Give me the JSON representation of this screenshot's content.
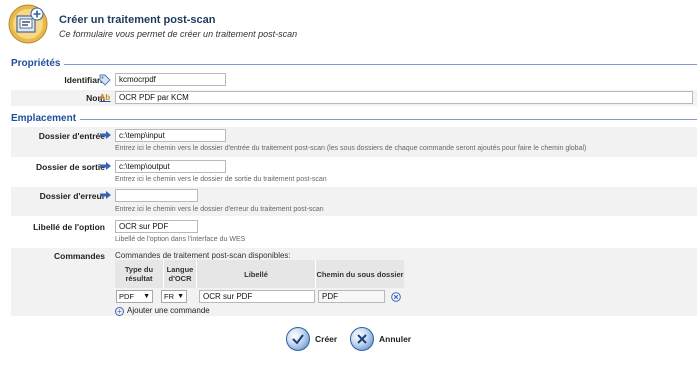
{
  "header": {
    "title": "Créer un traitement post-scan",
    "subtitle": "Ce formulaire vous permet de créer un traitement post-scan"
  },
  "proprietes": {
    "section_title": "Propriétés",
    "identifiant_label": "Identifiant",
    "identifiant_value": "kcmocrpdf",
    "nom_label": "Nom",
    "nom_value": "OCR PDF par KCM"
  },
  "emplacement": {
    "section_title": "Emplacement",
    "dossier_entree_label": "Dossier d'entrée",
    "dossier_entree_value": "c:\\temp\\input",
    "dossier_entree_help": "Entrez ici le chemin vers le dossier d'entrée du traitement post-scan (les sous dossiers de chaque commande seront ajoutés pour faire le chemin global)",
    "dossier_sortie_label": "Dossier de sortie",
    "dossier_sortie_value": "c:\\temp\\output",
    "dossier_sortie_help": "Entrez ici le chemin vers le dossier de sortie du traitement post-scan",
    "dossier_erreur_label": "Dossier d'erreur",
    "dossier_erreur_value": "",
    "dossier_erreur_help": "Entrez ici le chemin vers le dossier d'erreur du traitement post-scan",
    "libelle_option_label": "Libellé de l'option",
    "libelle_option_value": "OCR sur PDF",
    "libelle_option_help": "Libellé de l'option dans l'interface du WES"
  },
  "commandes": {
    "label": "Commandes",
    "caption": "Commandes de traitement post-scan disponibles:",
    "columns": [
      "Type du résultat",
      "Langue d'OCR",
      "Libellé",
      "Chemin du sous dossier"
    ],
    "row": {
      "type": "PDF",
      "langue": "FR",
      "libelle": "OCR sur PDF",
      "chemin": "PDF"
    },
    "add_label": "Ajouter une commande"
  },
  "buttons": {
    "create": "Créer",
    "cancel": "Annuler"
  },
  "colors": {
    "section": "#1f4f9a",
    "title": "#1c3a5e",
    "accent": "#3a63b8"
  }
}
